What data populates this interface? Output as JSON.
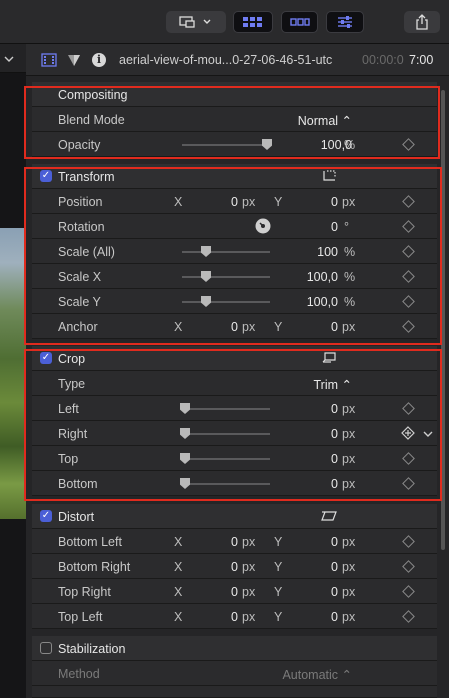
{
  "header": {
    "clip_name": "aerial-view-of-mou...0-27-06-46-51-utc",
    "timecode_dim": "00:00:0",
    "timecode": "7:00"
  },
  "compositing": {
    "title": "Compositing",
    "blend_mode_label": "Blend Mode",
    "blend_mode_value": "Normal ⌃",
    "opacity_label": "Opacity",
    "opacity_value": "100,0",
    "opacity_unit": "%"
  },
  "transform": {
    "title": "Transform",
    "position_label": "Position",
    "position_x": "0",
    "position_y": "0",
    "rotation_label": "Rotation",
    "rotation_value": "0",
    "rotation_unit": "°",
    "scale_all_label": "Scale (All)",
    "scale_all_value": "100",
    "scale_x_label": "Scale X",
    "scale_x_value": "100,0",
    "scale_y_label": "Scale Y",
    "scale_y_value": "100,0",
    "anchor_label": "Anchor",
    "anchor_x": "0",
    "anchor_y": "0"
  },
  "crop": {
    "title": "Crop",
    "type_label": "Type",
    "type_value": "Trim ⌃",
    "left_label": "Left",
    "left_value": "0",
    "right_label": "Right",
    "right_value": "0",
    "top_label": "Top",
    "top_value": "0",
    "bottom_label": "Bottom",
    "bottom_value": "0"
  },
  "distort": {
    "title": "Distort",
    "bottom_left_label": "Bottom Left",
    "bottom_left_x": "0",
    "bottom_left_y": "0",
    "bottom_right_label": "Bottom Right",
    "bottom_right_x": "0",
    "bottom_right_y": "0",
    "top_right_label": "Top Right",
    "top_right_x": "0",
    "top_right_y": "0",
    "top_left_label": "Top Left",
    "top_left_x": "0",
    "top_left_y": "0"
  },
  "stabilization": {
    "title": "Stabilization",
    "method_label": "Method",
    "method_value": "Automatic ⌃"
  },
  "common": {
    "x": "X",
    "y": "Y",
    "px": "px",
    "pct": "%"
  },
  "colors": {
    "accent": "#4b5fd6",
    "highlight_border": "#e02b1e"
  }
}
